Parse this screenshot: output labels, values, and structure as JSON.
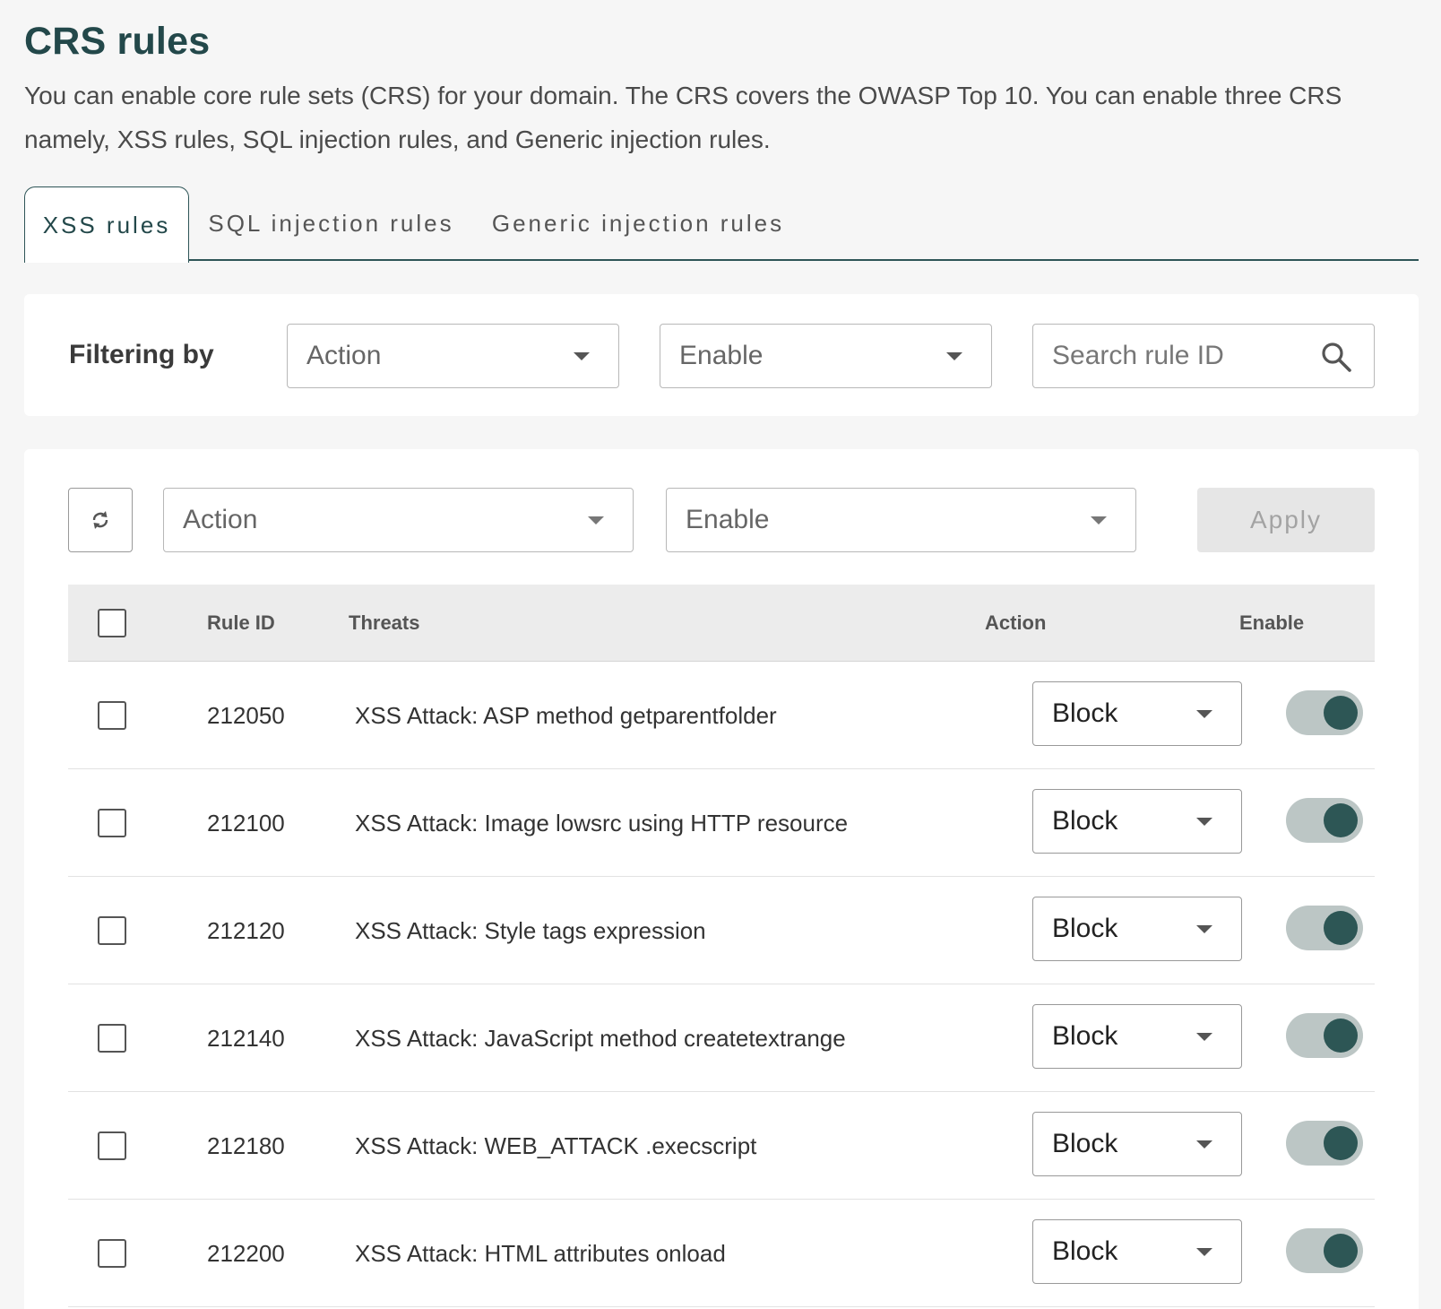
{
  "page": {
    "title": "CRS rules",
    "description": "You can enable core rule sets (CRS) for your domain. The CRS covers the OWASP Top 10. You can enable three CRS namely, XSS rules, SQL injection rules, and Generic injection rules."
  },
  "tabs": [
    {
      "label": "XSS rules",
      "active": true
    },
    {
      "label": "SQL injection rules",
      "active": false
    },
    {
      "label": "Generic injection rules",
      "active": false
    }
  ],
  "filter": {
    "label": "Filtering by",
    "action_value": "Action",
    "enable_value": "Enable",
    "search_placeholder": "Search rule ID"
  },
  "bulk": {
    "action_value": "Action",
    "enable_value": "Enable",
    "apply_label": "Apply"
  },
  "table": {
    "columns": {
      "rule_id": "Rule ID",
      "threats": "Threats",
      "action": "Action",
      "enable": "Enable"
    },
    "rows": [
      {
        "rule_id": "212050",
        "threat": "XSS Attack: ASP method getparentfolder",
        "action": "Block",
        "enabled": true
      },
      {
        "rule_id": "212100",
        "threat": "XSS Attack: Image lowsrc using HTTP resource",
        "action": "Block",
        "enabled": true
      },
      {
        "rule_id": "212120",
        "threat": "XSS Attack: Style tags expression",
        "action": "Block",
        "enabled": true
      },
      {
        "rule_id": "212140",
        "threat": "XSS Attack: JavaScript method createtextrange",
        "action": "Block",
        "enabled": true
      },
      {
        "rule_id": "212180",
        "threat": "XSS Attack: WEB_ATTACK .execscript",
        "action": "Block",
        "enabled": true
      },
      {
        "rule_id": "212200",
        "threat": "XSS Attack: HTML attributes onload",
        "action": "Block",
        "enabled": true
      }
    ]
  },
  "colors": {
    "brand_dark": "#23484a",
    "toggle_track": "#bcc6c5",
    "toggle_knob": "#2d5655"
  }
}
